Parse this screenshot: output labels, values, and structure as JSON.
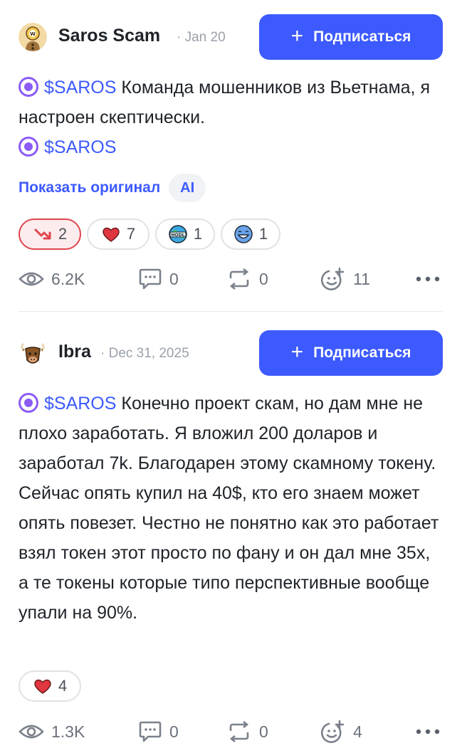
{
  "posts": [
    {
      "username": "Saros Scam",
      "date": "· Jan 20",
      "follow_label": "Подписаться",
      "tag": "$SAROS",
      "text_1": " Команда мошенников из Вьетнама, я настроен скептически.",
      "tag_2": "$SAROS",
      "show_original": "Показать оригинал",
      "ai_badge": "AI",
      "reactions": [
        {
          "icon": "bearish-arrow-icon",
          "count": "2",
          "active": true
        },
        {
          "icon": "heart-icon",
          "count": "7"
        },
        {
          "icon": "hodl-globe-icon",
          "count": "1"
        },
        {
          "icon": "laughing-face-icon",
          "count": "1"
        }
      ],
      "stats": {
        "views": "6.2K",
        "comments": "0",
        "reposts": "0",
        "reactions_add": "11"
      }
    },
    {
      "username": "Ibra",
      "date": "· Dec 31, 2025",
      "follow_label": "Подписаться",
      "tag": "$SAROS",
      "text_1": " Конечно проект скам, но дам мне не плохо заработать. Я вложил 200 доларов и заработал 7k. Благодарен этому скамному токену. Сейчас опять купил на 40$, кто его знаем может опять повезет. Честно не понятно как это работает взял токен этот просто по фану и он дал мне 35x, а те токены которые типо перспективные вообще упали на 90%.",
      "reactions": [
        {
          "icon": "heart-icon",
          "count": "4"
        }
      ],
      "stats": {
        "views": "1.3K",
        "comments": "0",
        "reposts": "0",
        "reactions_add": "4"
      }
    }
  ],
  "colors": {
    "accent": "#3d5afe",
    "muted": "#6a717b",
    "bearish": "#e0454d"
  }
}
